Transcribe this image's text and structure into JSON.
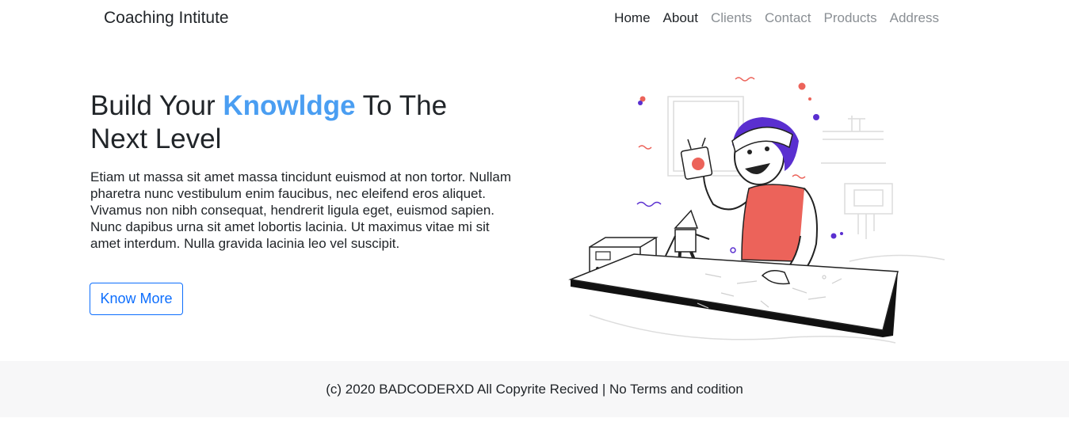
{
  "navbar": {
    "brand": "Coaching Intitute",
    "links": [
      "Home",
      "About",
      "Clients",
      "Contact",
      "Products",
      "Address"
    ]
  },
  "hero": {
    "title_part1": "Build Your ",
    "title_highlight": "Knowldge",
    "title_part2": " To The Next Level",
    "description": "Etiam ut massa sit amet massa tincidunt euismod at non tortor. Nullam pharetra nunc vestibulum enim faucibus, nec eleifend eros aliquet. Vivamus non nibh consequat, hendrerit ligula eget, euismod sapien. Nunc dapibus urna sit amet lobortis lacinia. Ut maximus vitae mi sit amet interdum. Nulla gravida lacinia leo vel suscipit.",
    "button_label": "Know More"
  },
  "footer": {
    "text": "(c) 2020 BADCODERXD All Copyrite Recived | No Terms and codition"
  },
  "colors": {
    "accent": "#4a9ef2",
    "button_border": "#0d6efd",
    "shirt": "#ec635a",
    "hair": "#5a2fd0",
    "footer_bg": "#f7f7f8"
  }
}
